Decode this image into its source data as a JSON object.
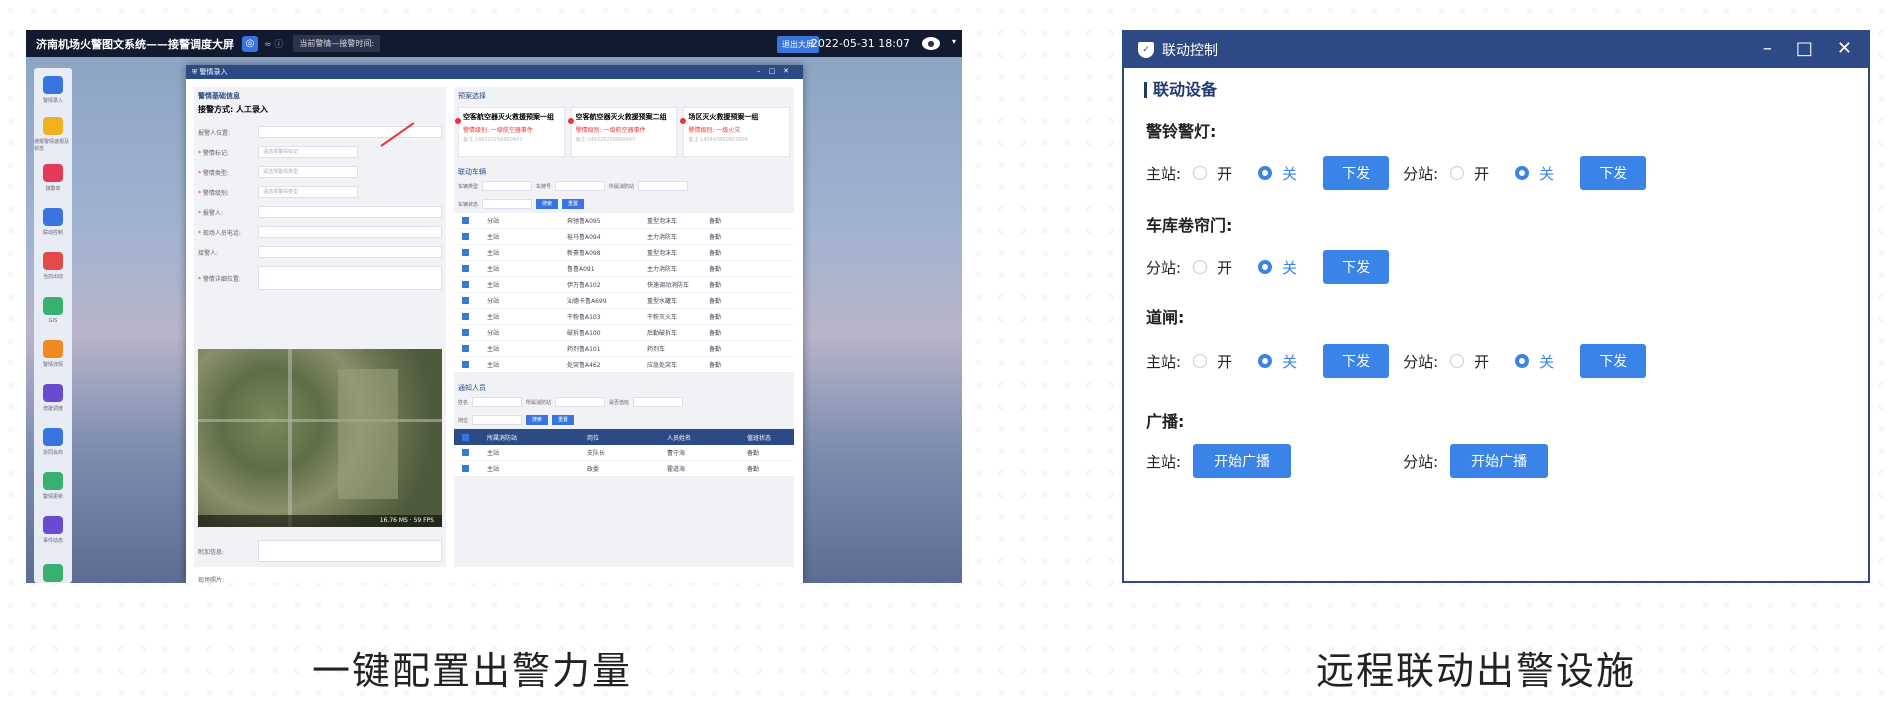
{
  "left_screen": {
    "title": "济南机场火警图文系统——接警调度大屏",
    "alarm_bar": "当前警情—接警时间:",
    "big_screen_btn": "退出大屏",
    "datetime": "2022-05-31 18:07",
    "sidebar_items": [
      "警情录入",
      "通报警情速报及状态",
      "接警单",
      "联动控制",
      "当前出动",
      "GIS",
      "警情详情",
      "增援调度",
      "协同会商",
      "警情更新",
      "事件动态",
      ""
    ],
    "modal_title": "警情录入",
    "left_section": "警情基础信息",
    "entry_method": "接警方式: 人工录入",
    "fields": [
      {
        "label": "报警人位置:",
        "required": false,
        "placeholder": ""
      },
      {
        "label": "警情标记:",
        "required": true,
        "placeholder": "请选择警情标记"
      },
      {
        "label": "警情类型:",
        "required": true,
        "placeholder": "请选择警情类型"
      },
      {
        "label": "警情级别:",
        "required": true,
        "placeholder": "请选择警情类型"
      },
      {
        "label": "报警人:",
        "required": true,
        "placeholder": ""
      },
      {
        "label": "现场人员电话:",
        "required": true,
        "placeholder": ""
      },
      {
        "label": "接警人:",
        "required": false,
        "placeholder": ""
      },
      {
        "label": "警情详细位置:",
        "required": true,
        "placeholder": ""
      }
    ],
    "map_status": "16.76 MS  ·  59 FPS",
    "extra_info": "附加信息:",
    "scene_photo": "现场照片:",
    "plan_section": "预案选择",
    "plans": [
      {
        "name": "空客航空器灭火救援预案一组",
        "level": "警情级别: 一级航空器事件",
        "note": "备注:146320256860447"
      },
      {
        "name": "空客航空器灭火救援预案二组",
        "level": "警情级别: 一级航空器事件",
        "note": "备注:146320256860447"
      },
      {
        "name": "场区灭火救援预案一组",
        "level": "警情级别: 一级火灾",
        "note": "备注:145443860663904"
      }
    ],
    "vehicle_section": "联动车辆",
    "vehicle_filters": [
      "车辆类型",
      "车牌号",
      "所属消防站"
    ],
    "vehicle_status_label": "车辆状态",
    "search_btn": "搜索",
    "reset_btn": "重置",
    "vehicles": [
      [
        "分站",
        "奔驰鲁A095",
        "重型泡沫车",
        "备勤"
      ],
      [
        "主站",
        "裕马鲁A094",
        "主力消防车",
        "备勤"
      ],
      [
        "主站",
        "新豪鲁A098",
        "重型泡沫车",
        "备勤"
      ],
      [
        "主站",
        "鲁鲁A091",
        "主力消防车",
        "备勤"
      ],
      [
        "主站",
        "伊万鲁A102",
        "快速调动消防车",
        "备勤"
      ],
      [
        "分站",
        "汕德卡鲁A699",
        "重型水罐车",
        "备勤"
      ],
      [
        "主站",
        "干粉鲁A103",
        "干粉灭火车",
        "备勤"
      ],
      [
        "分站",
        "破拆鲁A100",
        "后勤破拆车",
        "备勤"
      ],
      [
        "主站",
        "药剂鲁A101",
        "药剂车",
        "备勤"
      ],
      [
        "主站",
        "处突鲁A462",
        "应急处突车",
        "备勤"
      ]
    ],
    "notify_section": "通知人员",
    "notify_filters": [
      "姓名",
      "所属消防站",
      "是否值班"
    ],
    "position_label": "岗位",
    "notify_headers": [
      "所属消防站",
      "岗位",
      "人员姓名",
      "值班状态"
    ],
    "notify_rows": [
      [
        "主站",
        "支队长",
        "曹守海",
        "备勤"
      ],
      [
        "主站",
        "政委",
        "霍道海",
        "备勤"
      ]
    ]
  },
  "right_screen": {
    "title": "联动控制",
    "section": "联动设备",
    "groups": [
      {
        "name": "警铃警灯:",
        "controls": [
          {
            "station": "主站:",
            "on": "开",
            "off": "关",
            "selected": "off",
            "button": "下发"
          },
          {
            "station": "分站:",
            "on": "开",
            "off": "关",
            "selected": "off",
            "button": "下发"
          }
        ]
      },
      {
        "name": "车库卷帘门:",
        "controls": [
          {
            "station": "分站:",
            "on": "开",
            "off": "关",
            "selected": "off",
            "button": "下发"
          }
        ]
      },
      {
        "name": "道闸:",
        "controls": [
          {
            "station": "主站:",
            "on": "开",
            "off": "关",
            "selected": "off",
            "button": "下发"
          },
          {
            "station": "分站:",
            "on": "开",
            "off": "关",
            "selected": "off",
            "button": "下发"
          }
        ]
      },
      {
        "name": "广播:",
        "controls": [
          {
            "station": "主站:",
            "button": "开始广播"
          },
          {
            "station": "分站:",
            "button": "开始广播"
          }
        ]
      }
    ]
  },
  "captions": {
    "left": "一键配置出警力量",
    "right": "远程联动出警设施"
  }
}
